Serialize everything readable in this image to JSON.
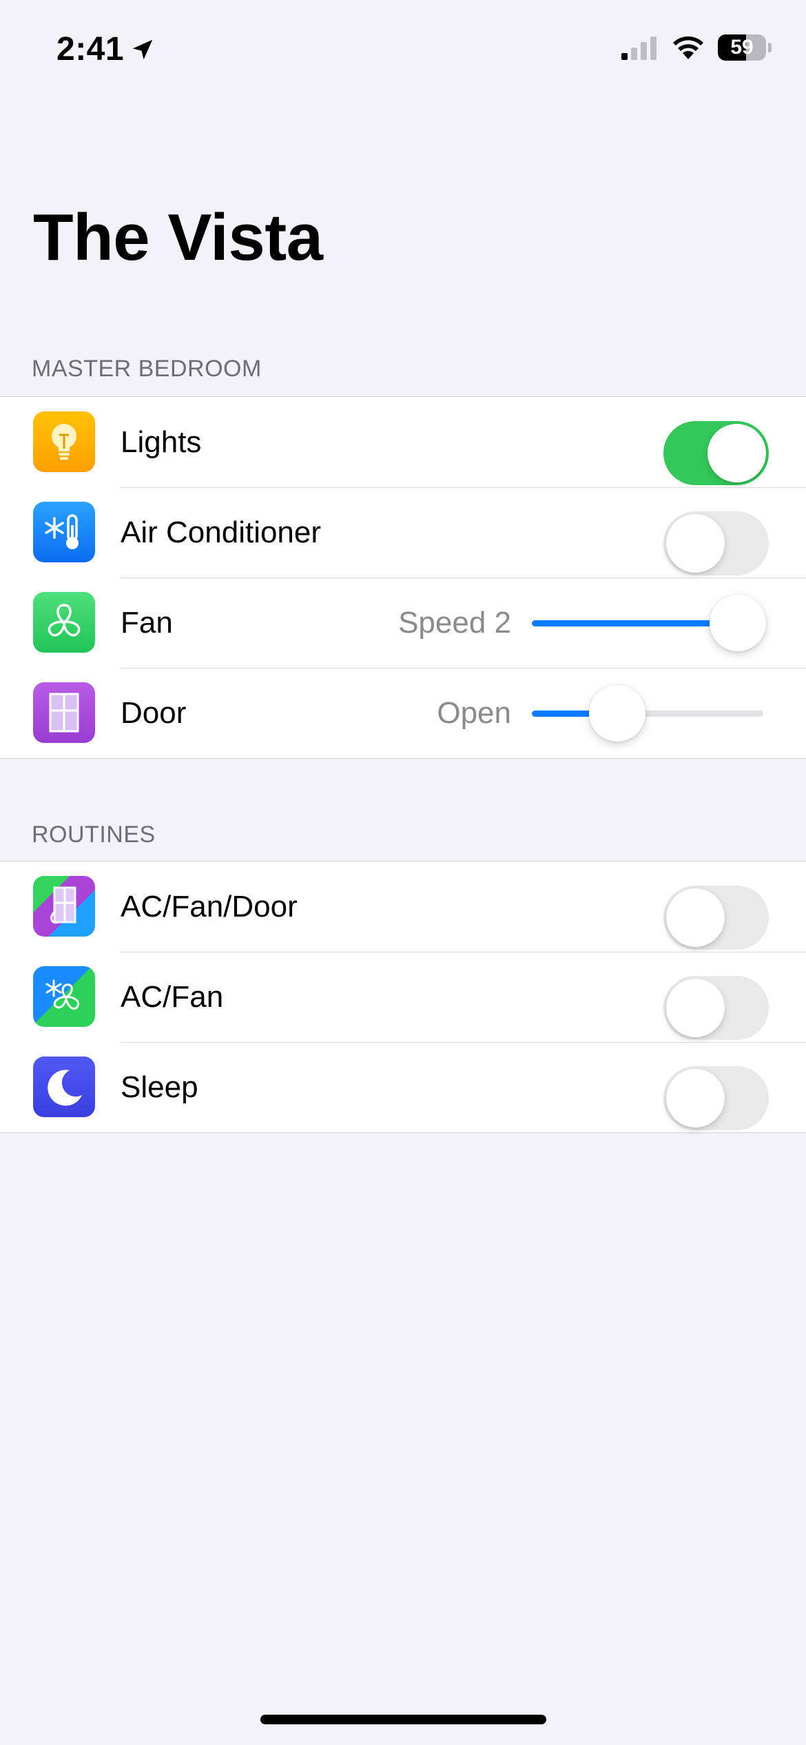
{
  "status_bar": {
    "time": "2:41",
    "battery": "59",
    "battery_level": 0.59
  },
  "page_title": "The Vista",
  "sections": {
    "master_bedroom": "MASTER BEDROOM",
    "routines": "ROUTINES"
  },
  "devices": {
    "lights": {
      "label": "Lights",
      "icon": "lightbulb-icon",
      "on": true,
      "tile_color": "#ffb300"
    },
    "air_conditioner": {
      "label": "Air Conditioner",
      "icon": "thermometer-snowflake-icon",
      "on": false,
      "tile_color": "#1a8cff"
    },
    "fan": {
      "label": "Fan",
      "icon": "fan-icon",
      "value_label": "Speed 2",
      "level": 0.89,
      "tile_color": "#2ed158"
    },
    "door": {
      "label": "Door",
      "icon": "door-icon",
      "value_label": "Open",
      "level": 0.37,
      "tile_color": "#b04ad8"
    }
  },
  "routines": {
    "ac_fan_door": {
      "label": "AC/Fan/Door",
      "icon": "ac-fan-door-routine-icon",
      "on": false
    },
    "ac_fan": {
      "label": "AC/Fan",
      "icon": "ac-fan-routine-icon",
      "on": false
    },
    "sleep": {
      "label": "Sleep",
      "icon": "moon-icon",
      "on": false,
      "tile_color": "#4a4ef0"
    }
  },
  "colors": {
    "accent": "#0a7cff",
    "toggle_on": "#34c759",
    "background": "#f2f2f7"
  }
}
